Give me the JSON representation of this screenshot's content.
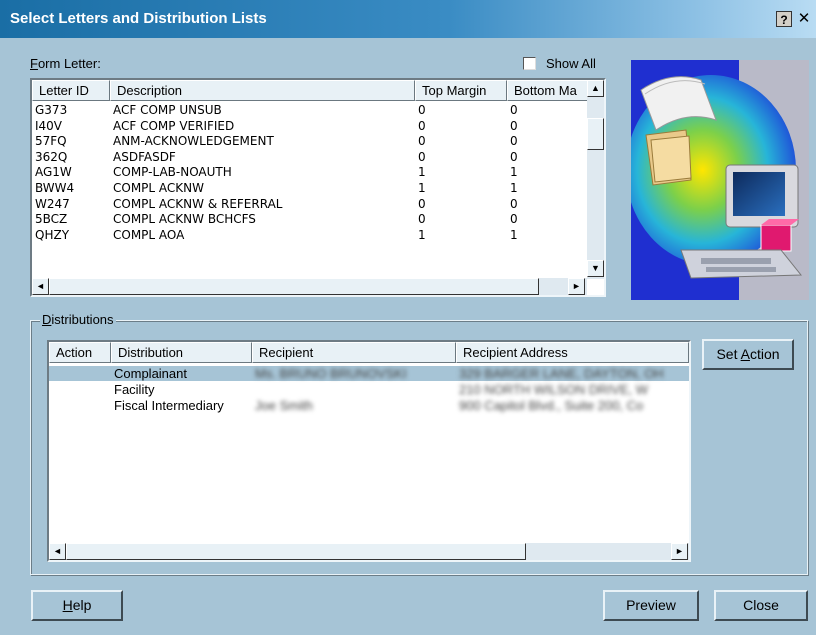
{
  "window": {
    "title": "Select Letters and Distribution Lists",
    "help_glyph": "?",
    "close_glyph": "✕"
  },
  "form_letter": {
    "label_prefix": "F",
    "label_rest": "orm Letter:",
    "show_all_label": "Show All",
    "columns": [
      "Letter ID",
      "Description",
      "Top Margin",
      "Bottom Ma"
    ],
    "rows": [
      {
        "id": "G373",
        "description": "ACF COMP UNSUB",
        "top": "0",
        "bottom": "0"
      },
      {
        "id": "I40V",
        "description": "ACF COMP VERIFIED",
        "top": "0",
        "bottom": "0"
      },
      {
        "id": "57FQ",
        "description": "ANM-ACKNOWLEDGEMENT",
        "top": "0",
        "bottom": "0"
      },
      {
        "id": "362Q",
        "description": "ASDFASDF",
        "top": "0",
        "bottom": "0"
      },
      {
        "id": "AG1W",
        "description": "COMP-LAB-NOAUTH",
        "top": "1",
        "bottom": "1"
      },
      {
        "id": "BWW4",
        "description": "COMPL ACKNW",
        "top": "1",
        "bottom": "1"
      },
      {
        "id": "W247",
        "description": "COMPL ACKNW & REFERRAL",
        "top": "0",
        "bottom": "0"
      },
      {
        "id": "5BCZ",
        "description": "COMPL ACKNW BCHCFS",
        "top": "0",
        "bottom": "0"
      },
      {
        "id": "QHZY",
        "description": "COMPL AOA",
        "top": "1",
        "bottom": "1"
      }
    ]
  },
  "distributions": {
    "label_prefix": "D",
    "label_rest": "istributions",
    "columns": [
      "Action",
      "Distribution",
      "Recipient",
      "Recipient Address"
    ],
    "rows": [
      {
        "action": "",
        "distribution": "Complainant",
        "recipient": "Ms. BRUNO BRUNOVSKI",
        "address": "329 BARGER LANE, DAYTON, OH",
        "selected": true
      },
      {
        "action": "",
        "distribution": "Facility",
        "recipient": "",
        "address": "210 NORTH WILSON DRIVE, W"
      },
      {
        "action": "",
        "distribution": "Fiscal Intermediary",
        "recipient": "Joe Smith",
        "address": "900 Capitol Blvd., Suite 200, Co"
      }
    ],
    "set_action_prefix": "Set ",
    "set_action_ul": "A",
    "set_action_rest": "ction"
  },
  "buttons": {
    "help_ul": "H",
    "help_rest": "elp",
    "preview": "Preview",
    "close": "Close"
  },
  "icons": {
    "scroll_up": "▲",
    "scroll_down": "▼",
    "scroll_left": "◄",
    "scroll_right": "►"
  }
}
